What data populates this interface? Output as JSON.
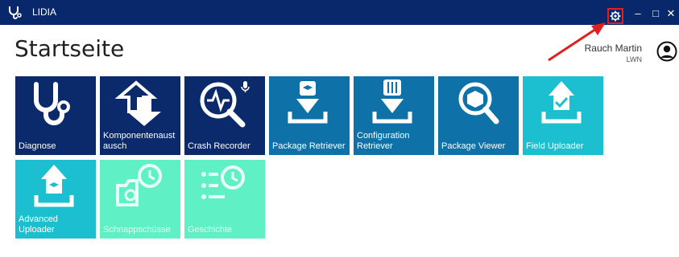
{
  "window": {
    "app_title": "LIDIA",
    "controls": {
      "minimize": "–",
      "maximize": "□",
      "close": "✕"
    }
  },
  "page": {
    "title": "Startseite"
  },
  "user": {
    "name": "Rauch Martin",
    "org": "LWN"
  },
  "colors": {
    "titlebar": "#08286b",
    "navy_tile": "#0a2a6b",
    "blue_tile": "#0e72a8",
    "cyan_tile": "#1bbfd0",
    "mint_tile": "#5ff0c6",
    "highlight": "#e02020"
  },
  "tiles": [
    {
      "label": "Diagnose",
      "icon": "stethoscope-icon",
      "color": "#0a2a6b"
    },
    {
      "label": "Komponentenaustausch",
      "icon": "component-swap-icon",
      "color": "#0a2a6b"
    },
    {
      "label": "Crash Recorder",
      "icon": "crash-recorder-icon",
      "color": "#0a2a6b"
    },
    {
      "label": "Package Retriever",
      "icon": "package-download-icon",
      "color": "#0e72a8"
    },
    {
      "label": "Configuration Retriever",
      "icon": "config-download-icon",
      "color": "#0e72a8"
    },
    {
      "label": "Package Viewer",
      "icon": "package-search-icon",
      "color": "#0e72a8"
    },
    {
      "label": "Field Uploader",
      "icon": "field-upload-icon",
      "color": "#1bbfd0"
    },
    {
      "label": "Advanced Uploader",
      "icon": "advanced-upload-icon",
      "color": "#1bbfd0"
    },
    {
      "label": "Schnappschüsse",
      "icon": "snapshot-camera-icon",
      "color": "#5ff0c6"
    },
    {
      "label": "Geschichte",
      "icon": "history-icon",
      "color": "#5ff0c6"
    }
  ]
}
